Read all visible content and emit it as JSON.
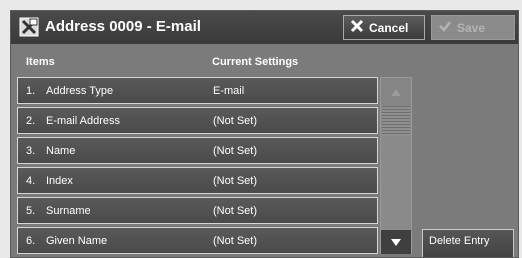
{
  "title": "Address 0009 - E-mail",
  "buttons": {
    "cancel": "Cancel",
    "save": "Save",
    "delete_entry": "Delete Entry"
  },
  "columns": {
    "items": "Items",
    "current_settings": "Current Settings"
  },
  "rows": [
    {
      "num": "1.",
      "label": "Address Type",
      "value": "E-mail"
    },
    {
      "num": "2.",
      "label": "E-mail Address",
      "value": "(Not Set)"
    },
    {
      "num": "3.",
      "label": "Name",
      "value": "(Not Set)"
    },
    {
      "num": "4.",
      "label": "Index",
      "value": "(Not Set)"
    },
    {
      "num": "5.",
      "label": "Surname",
      "value": "(Not Set)"
    },
    {
      "num": "6.",
      "label": "Given Name",
      "value": "(Not Set)"
    }
  ],
  "colors": {
    "title_bar": "#3f3f3f",
    "panel": "#7b7b7b",
    "row": "#505050"
  },
  "icons": {
    "title": "address-card-icon",
    "cancel": "close-icon",
    "save": "check-icon"
  }
}
